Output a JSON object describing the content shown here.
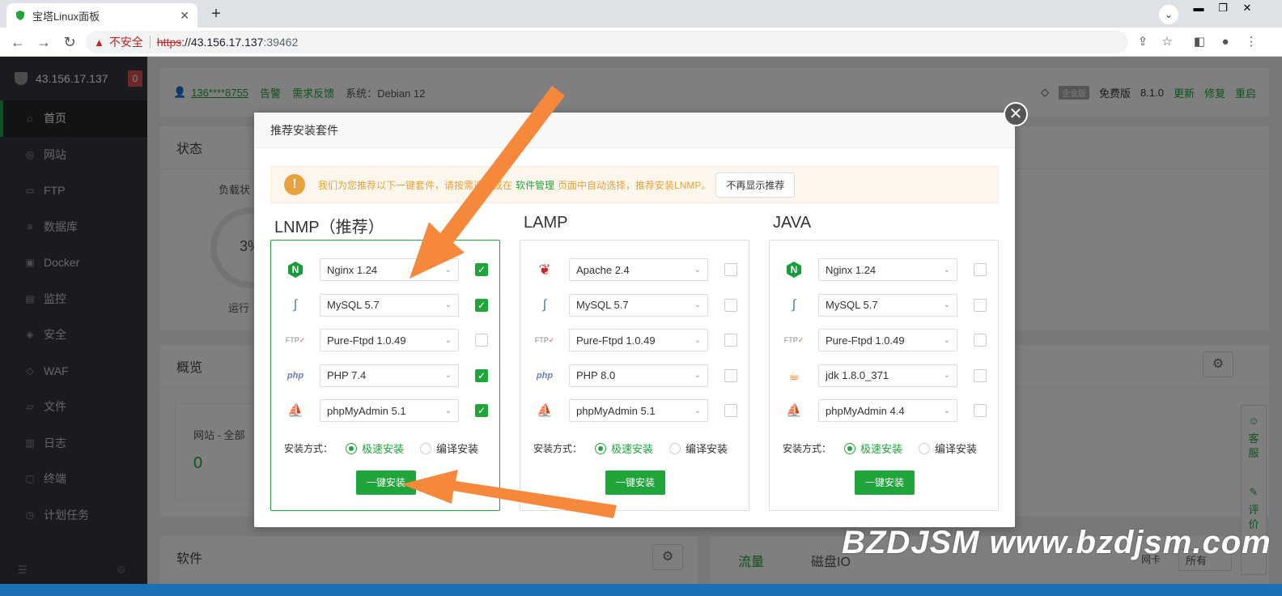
{
  "browser": {
    "tab_title": "宝塔Linux面板",
    "insecure_label": "不安全",
    "url_scheme": "https",
    "url_host": "://43.156.17.137",
    "url_port": ":39462"
  },
  "sidebar": {
    "server": "43.156.17.137",
    "badge": "0",
    "items": [
      {
        "label": "首页",
        "icon": "home-icon"
      },
      {
        "label": "网站",
        "icon": "globe-icon"
      },
      {
        "label": "FTP",
        "icon": "ftp-icon"
      },
      {
        "label": "数据库",
        "icon": "database-icon"
      },
      {
        "label": "Docker",
        "icon": "docker-icon"
      },
      {
        "label": "监控",
        "icon": "monitor-icon"
      },
      {
        "label": "安全",
        "icon": "shield-icon"
      },
      {
        "label": "WAF",
        "icon": "waf-icon"
      },
      {
        "label": "文件",
        "icon": "folder-icon"
      },
      {
        "label": "日志",
        "icon": "log-icon"
      },
      {
        "label": "终端",
        "icon": "terminal-icon"
      },
      {
        "label": "计划任务",
        "icon": "clock-icon"
      }
    ]
  },
  "topbar": {
    "user": "136****8755",
    "alert": "告警",
    "feedback": "需求反馈",
    "system": "系统：Debian 12",
    "pro": "企业版",
    "free": "免费版",
    "version": "8.1.0",
    "update": "更新",
    "repair": "修复",
    "restart": "重启"
  },
  "background": {
    "status_title": "状态",
    "load_label": "负载状",
    "load_value": "3%",
    "running_label": "运行",
    "overview_title": "概览",
    "site_label": "网站 - 全部",
    "site_count": "0",
    "software_title": "软件",
    "traffic_tab": "流量",
    "diskio_tab": "磁盘IO",
    "nic_label": "网卡",
    "nic_value": "所有",
    "float_service": "客服",
    "float_review": "评价"
  },
  "modal": {
    "title": "推荐安装套件",
    "notice_before": "我们为您推荐以下一键套件，请按需选择或在",
    "notice_link": "软件管理",
    "notice_after": "页面中自动选择，推荐安装LNMP。",
    "notice_button": "不再显示推荐",
    "install_mode_label": "安装方式：",
    "fast_install": "极速安装",
    "compile_install": "编译安装",
    "install_button": "一键安装",
    "groups": [
      {
        "title": "LNMP（推荐）",
        "rows": [
          {
            "icon": "nginx-icon",
            "value": "Nginx 1.24",
            "checked": true
          },
          {
            "icon": "mysql-icon",
            "value": "MySQL 5.7",
            "checked": true
          },
          {
            "icon": "ftp-icon",
            "value": "Pure-Ftpd 1.0.49",
            "checked": false
          },
          {
            "icon": "php-icon",
            "value": "PHP 7.4",
            "checked": true
          },
          {
            "icon": "phpmyadmin-icon",
            "value": "phpMyAdmin 5.1",
            "checked": true
          }
        ]
      },
      {
        "title": "LAMP",
        "rows": [
          {
            "icon": "apache-icon",
            "value": "Apache 2.4",
            "checked": false
          },
          {
            "icon": "mysql-icon",
            "value": "MySQL 5.7",
            "checked": false
          },
          {
            "icon": "ftp-icon",
            "value": "Pure-Ftpd 1.0.49",
            "checked": false
          },
          {
            "icon": "php-icon",
            "value": "PHP 8.0",
            "checked": false
          },
          {
            "icon": "phpmyadmin-icon",
            "value": "phpMyAdmin 5.1",
            "checked": false
          }
        ]
      },
      {
        "title": "JAVA",
        "rows": [
          {
            "icon": "nginx-icon",
            "value": "Nginx 1.24",
            "checked": false
          },
          {
            "icon": "mysql-icon",
            "value": "MySQL 5.7",
            "checked": false
          },
          {
            "icon": "ftp-icon",
            "value": "Pure-Ftpd 1.0.49",
            "checked": false
          },
          {
            "icon": "java-icon",
            "value": "jdk 1.8.0_371",
            "checked": false
          },
          {
            "icon": "phpmyadmin-icon",
            "value": "phpMyAdmin 4.4",
            "checked": false
          }
        ]
      }
    ]
  },
  "watermark": "BZDJSM www.bzdjsm.com",
  "colors": {
    "accent_green": "#20a53a",
    "sidebar_bg": "#33373d",
    "arrow_orange": "#f5883a",
    "warning": "#e6a23c"
  }
}
